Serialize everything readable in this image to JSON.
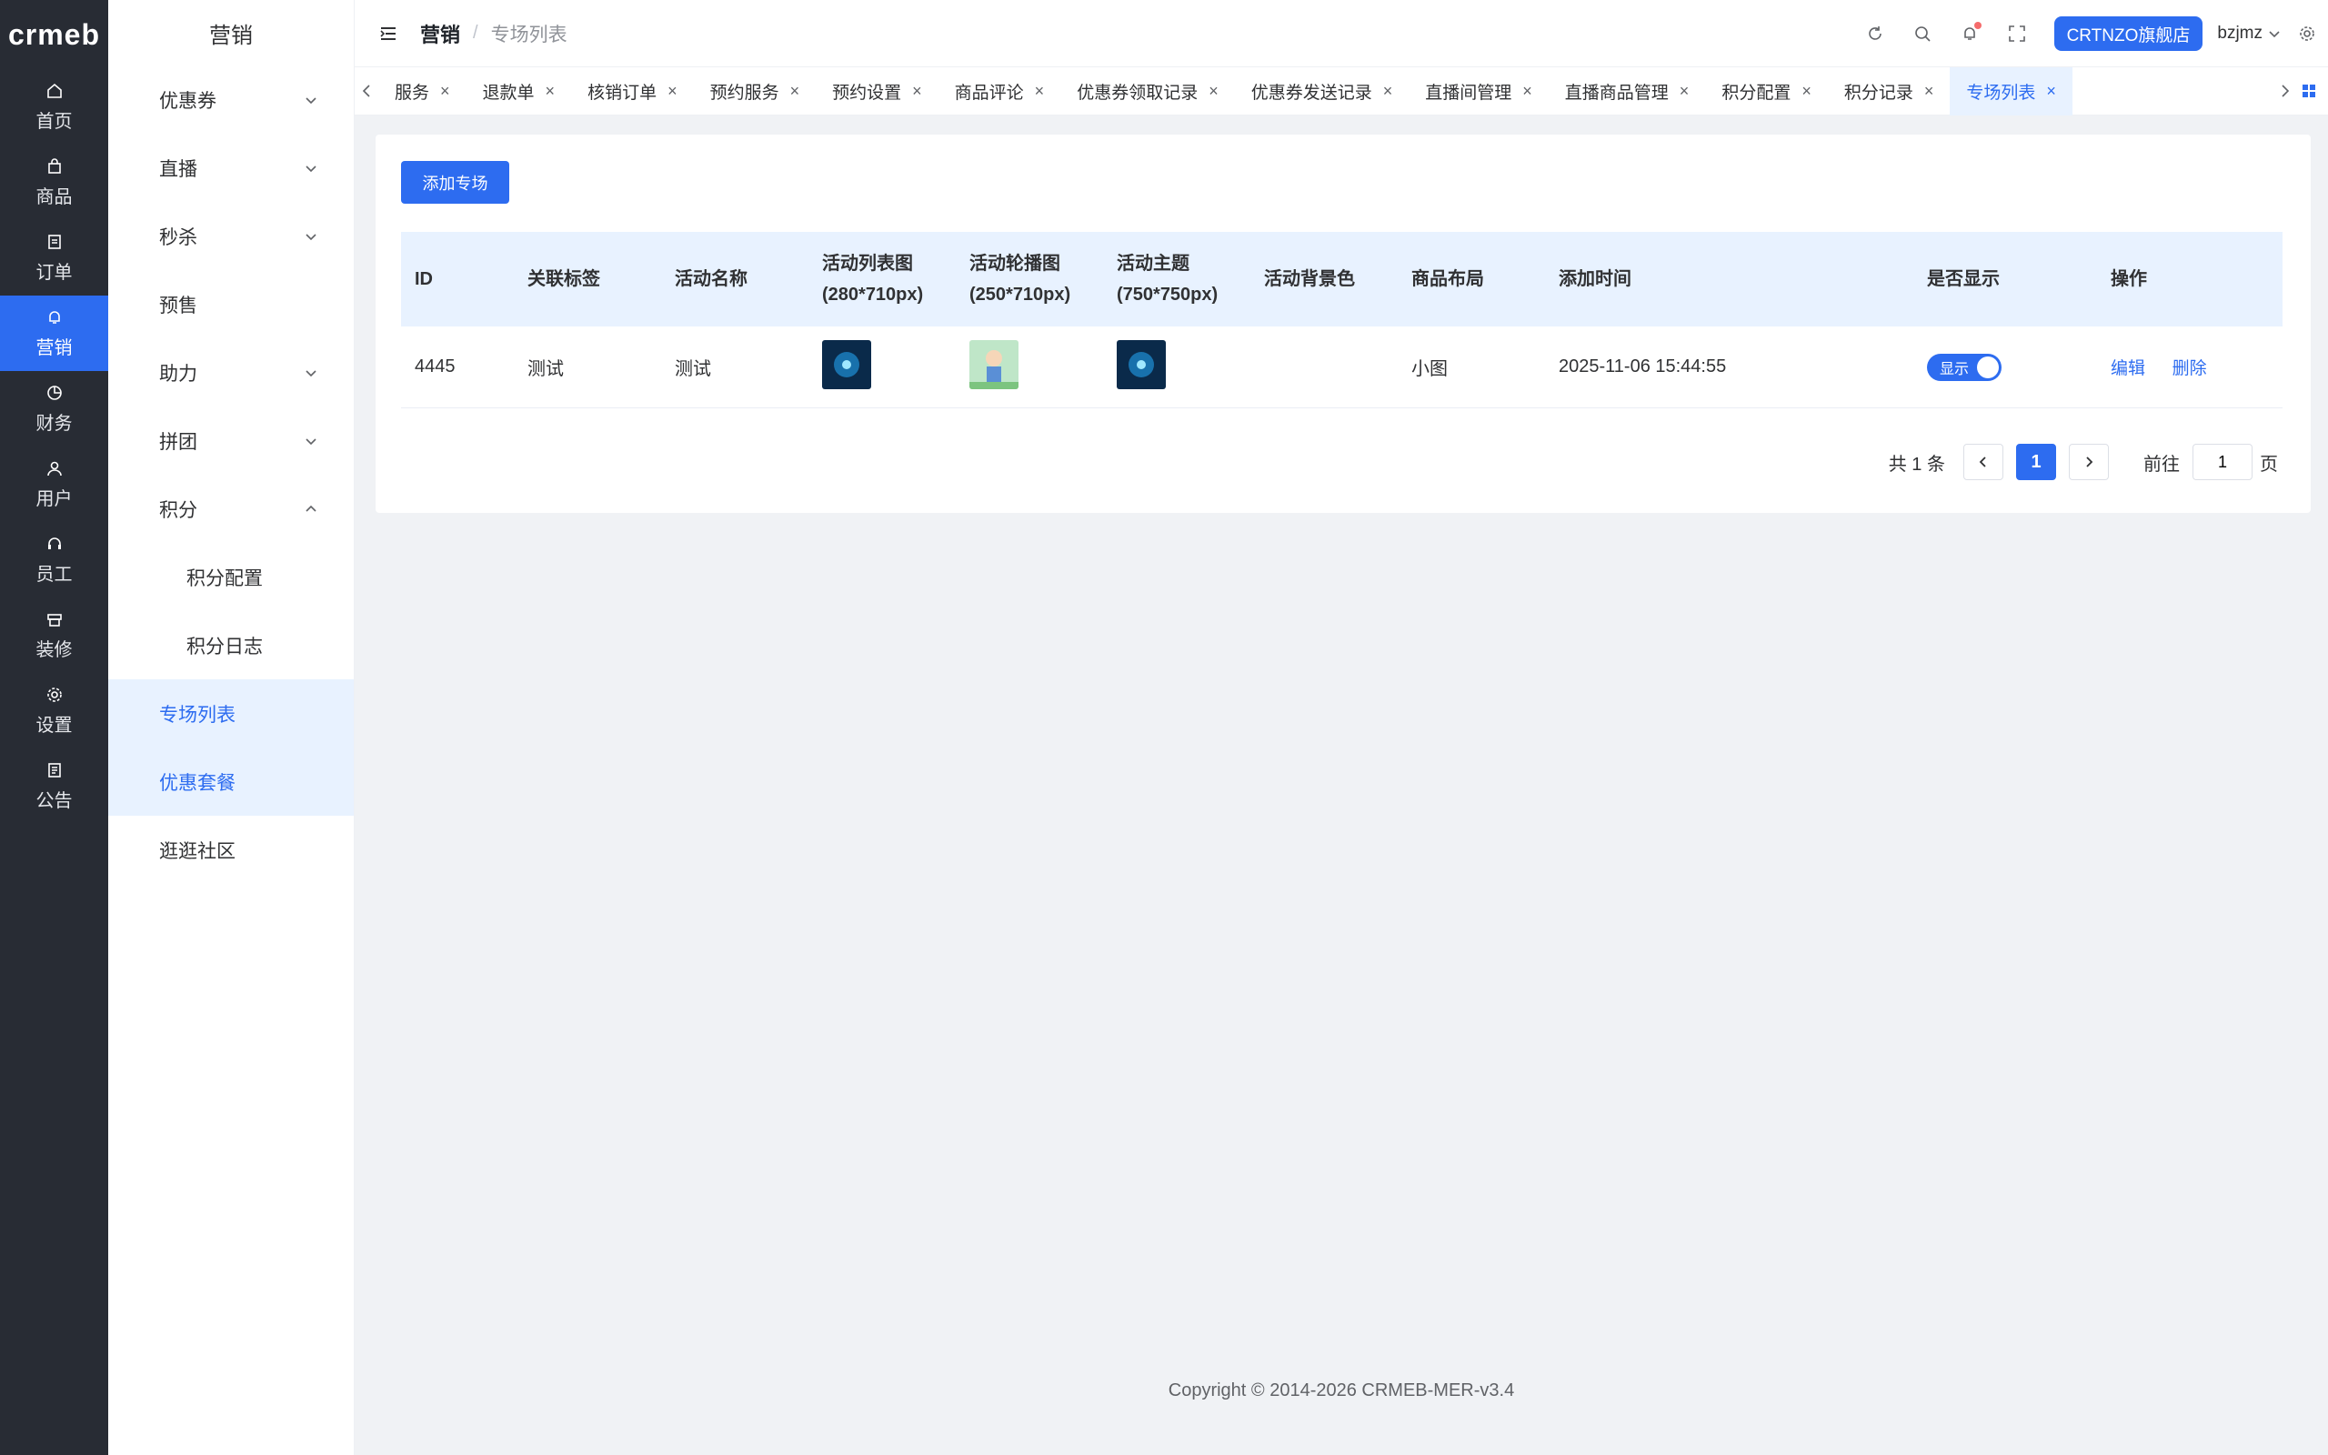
{
  "logo": "crmeb",
  "rail": [
    {
      "label": "首页",
      "icon": "home-icon"
    },
    {
      "label": "商品",
      "icon": "bag-icon"
    },
    {
      "label": "订单",
      "icon": "document-icon"
    },
    {
      "label": "营销",
      "icon": "bell-icon"
    },
    {
      "label": "财务",
      "icon": "pie-icon"
    },
    {
      "label": "用户",
      "icon": "user-icon"
    },
    {
      "label": "员工",
      "icon": "headset-icon"
    },
    {
      "label": "装修",
      "icon": "box-icon"
    },
    {
      "label": "设置",
      "icon": "gear-icon"
    },
    {
      "label": "公告",
      "icon": "notice-icon"
    }
  ],
  "submenu": {
    "title": "营销",
    "items": [
      {
        "label": "优惠券"
      },
      {
        "label": "直播"
      },
      {
        "label": "秒杀"
      },
      {
        "label": "预售"
      },
      {
        "label": "助力"
      },
      {
        "label": "拼团"
      },
      {
        "label": "积分"
      },
      {
        "label": "积分配置"
      },
      {
        "label": "积分日志"
      },
      {
        "label": "专场列表"
      },
      {
        "label": "优惠套餐"
      },
      {
        "label": "逛逛社区"
      }
    ]
  },
  "header": {
    "crumb_main": "营销",
    "crumb_sep": "/",
    "crumb_sub": "专场列表",
    "store": "CRTNZO旗舰店",
    "user": "bzjmz"
  },
  "tabs": [
    "服务",
    "退款单",
    "核销订单",
    "预约服务",
    "预约设置",
    "商品评论",
    "优惠券领取记录",
    "优惠券发送记录",
    "直播间管理",
    "直播商品管理",
    "积分配置",
    "积分记录",
    "专场列表"
  ],
  "tab_close": "×",
  "add_button": "添加专场",
  "table": {
    "headers": [
      "ID",
      "关联标签",
      "活动名称",
      "活动列表图(280*710px)",
      "活动轮播图(250*710px)",
      "活动主题(750*750px)",
      "活动背景色",
      "商品布局",
      "添加时间",
      "是否显示",
      "操作"
    ],
    "rows": [
      {
        "id": "4445",
        "tag": "测试",
        "name": "测试",
        "layout": "小图",
        "time": "2025-11-06 15:44:55",
        "show": "显示",
        "edit": "编辑",
        "del": "删除"
      }
    ]
  },
  "pagination": {
    "total": "共 1 条",
    "current": "1",
    "goto": "前往",
    "goto_value": "1",
    "unit": "页"
  },
  "footer": "Copyright © 2014-2026 CRMEB-MER-v3.4",
  "colors": {
    "primary": "#2d6cf0",
    "rail_bg": "#282c34",
    "highlight": "#e8f2ff"
  }
}
